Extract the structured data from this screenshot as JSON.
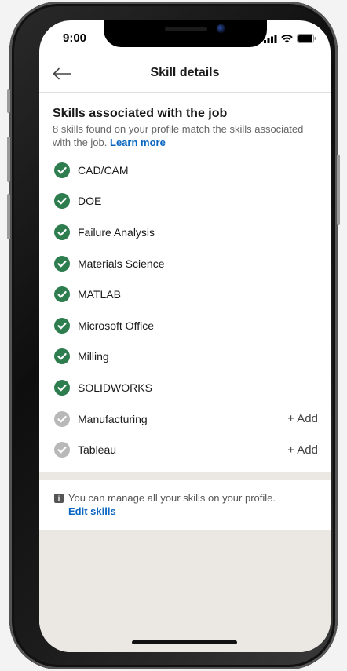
{
  "status_bar": {
    "time": "9:00"
  },
  "header": {
    "title": "Skill details"
  },
  "section": {
    "title": "Skills associated with the job",
    "description": "8 skills found on your profile match the skills associated with the job.",
    "learn_more": "Learn more"
  },
  "skills": [
    {
      "name": "CAD/CAM",
      "matched": true
    },
    {
      "name": "DOE",
      "matched": true
    },
    {
      "name": "Failure Analysis",
      "matched": true
    },
    {
      "name": "Materials Science",
      "matched": true
    },
    {
      "name": "MATLAB",
      "matched": true
    },
    {
      "name": "Microsoft Office",
      "matched": true
    },
    {
      "name": "Milling",
      "matched": true
    },
    {
      "name": "SOLIDWORKS",
      "matched": true
    },
    {
      "name": "Manufacturing",
      "matched": false,
      "action": "+ Add"
    },
    {
      "name": "Tableau",
      "matched": false,
      "action": "+ Add"
    }
  ],
  "footer": {
    "note": "You can manage all your skills on your profile.",
    "edit_link": "Edit skills"
  },
  "colors": {
    "matched": "#2e7d4f",
    "missing": "#b8b8b8",
    "link": "#0a66c2",
    "band": "#ebe7e2"
  },
  "icons": {
    "back": "arrow-left-icon",
    "matched": "check-circle-icon",
    "info": "info-icon"
  }
}
